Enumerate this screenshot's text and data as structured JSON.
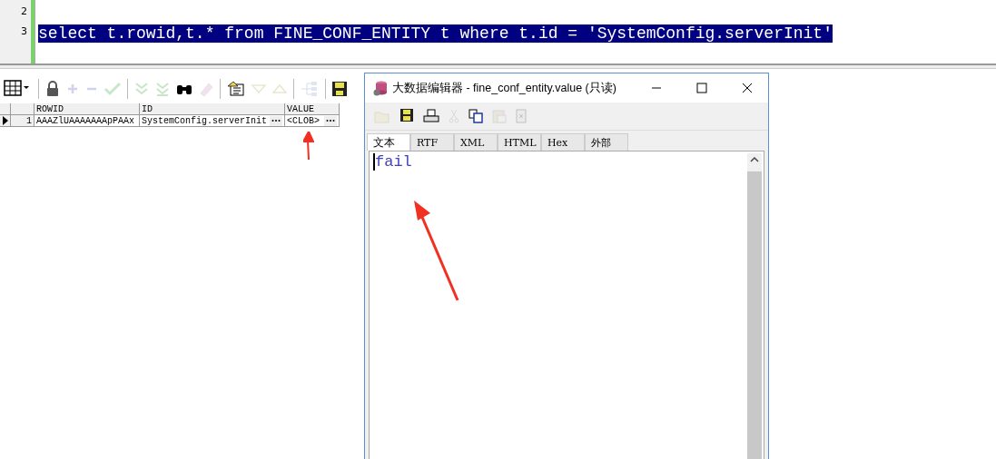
{
  "editor": {
    "lines": [
      {
        "number": "2"
      },
      {
        "number": "3",
        "text": "select t.rowid,t.* from FINE_CONF_ENTITY t where t.id = 'SystemConfig.serverInit'",
        "selected": true
      }
    ]
  },
  "toolbar": [
    {
      "kind": "grid",
      "disabled": false
    },
    {
      "kind": "lock",
      "disabled": false
    },
    {
      "kind": "plus",
      "disabled": true
    },
    {
      "kind": "minus",
      "disabled": true
    },
    {
      "kind": "check",
      "disabled": true
    },
    {
      "kind": "fetch-next",
      "disabled": true
    },
    {
      "kind": "fetch-all",
      "disabled": true
    },
    {
      "kind": "binoculars",
      "disabled": false
    },
    {
      "kind": "eraser",
      "disabled": true
    },
    {
      "kind": "query",
      "disabled": false
    },
    {
      "kind": "down",
      "disabled": true
    },
    {
      "kind": "up",
      "disabled": true
    },
    {
      "kind": "tree",
      "disabled": true
    },
    {
      "kind": "save",
      "disabled": false
    }
  ],
  "grid": {
    "columns": [
      "ROWID",
      "ID",
      "VALUE"
    ],
    "rows": [
      {
        "number": "1",
        "current": true,
        "cells": [
          "AAAZlUAAAAAAApPAAx",
          "SystemConfig.serverInit",
          "<CLOB>"
        ]
      }
    ]
  },
  "editor_window": {
    "title": "大数据编辑器 - fine_conf_entity.value (只读)",
    "toolbar": [
      {
        "kind": "open",
        "disabled": true
      },
      {
        "kind": "save",
        "disabled": false
      },
      {
        "kind": "print",
        "disabled": false
      },
      {
        "kind": "cut",
        "disabled": true
      },
      {
        "kind": "copy",
        "disabled": false
      },
      {
        "kind": "paste",
        "disabled": true
      },
      {
        "kind": "clear",
        "disabled": true
      }
    ],
    "tabs": [
      {
        "label": "文本",
        "selected": true
      },
      {
        "label": "RTF",
        "selected": false
      },
      {
        "label": "XML",
        "selected": false
      },
      {
        "label": "HTML",
        "selected": false
      },
      {
        "label": "Hex",
        "selected": false
      },
      {
        "label": "外部",
        "selected": false
      }
    ],
    "value": "fail"
  }
}
